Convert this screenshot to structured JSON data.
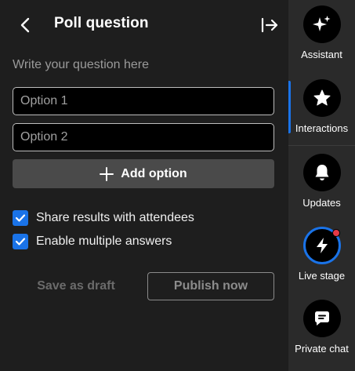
{
  "header": {
    "title": "Poll question"
  },
  "form": {
    "question_placeholder": "Write your question here",
    "options": [
      {
        "placeholder": "Option 1"
      },
      {
        "placeholder": "Option 2"
      }
    ],
    "add_option_label": "Add option",
    "checkboxes": [
      {
        "label": "Share results with attendees",
        "checked": true
      },
      {
        "label": "Enable multiple answers",
        "checked": true
      }
    ],
    "save_draft_label": "Save as draft",
    "publish_label": "Publish now"
  },
  "sidebar": {
    "items": [
      {
        "label": "Assistant",
        "icon": "sparkles-icon"
      },
      {
        "label": "Interactions",
        "icon": "star-icon",
        "active": true
      },
      {
        "label": "Updates",
        "icon": "bell-icon"
      },
      {
        "label": "Live stage",
        "icon": "lightning-icon",
        "notification": true
      },
      {
        "label": "Private chat",
        "icon": "chat-icon"
      }
    ]
  },
  "colors": {
    "accent": "#1a73e8",
    "panel_bg": "#1e1e1e",
    "sidebar_bg": "#2a2a2a",
    "notification": "#e53947"
  }
}
